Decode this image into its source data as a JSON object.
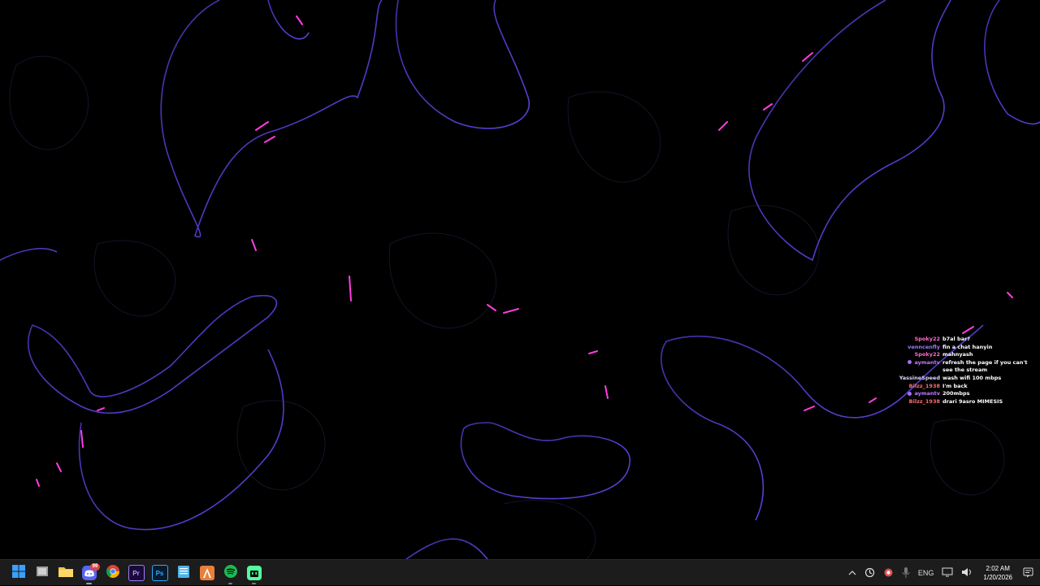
{
  "chat": {
    "messages": [
      {
        "user": "Spoky22",
        "color": "#ff6bd0",
        "badge": false,
        "text": "b7al bar?"
      },
      {
        "user": "venncenfly",
        "color": "#9a7bff",
        "badge": false,
        "text": "fin a chat hanyin"
      },
      {
        "user": "Spoky22",
        "color": "#ff6bd0",
        "badge": false,
        "text": "mahnyash"
      },
      {
        "user": "aymantv",
        "color": "#c07aff",
        "badge": true,
        "text": "refresh the page if you can't see the stream"
      },
      {
        "user": "YassineSpeed",
        "color": "#d9d9ff",
        "badge": false,
        "text": "wash wifi 100 mbps"
      },
      {
        "user": "Bilzz_1938",
        "color": "#ff6e6e",
        "badge": false,
        "text": "I'm back"
      },
      {
        "user": "aymantv",
        "color": "#c07aff",
        "badge": true,
        "text": "200mbps"
      },
      {
        "user": "Bilzz_1938",
        "color": "#ff6e6e",
        "badge": false,
        "text": "drari 9asro MIMESIS"
      }
    ]
  },
  "taskbar": {
    "apps": [
      {
        "name": "start-button",
        "icon": "windows-icon"
      },
      {
        "name": "task-view-button",
        "icon": "task-view-icon"
      },
      {
        "name": "file-explorer-button",
        "icon": "folder-icon"
      },
      {
        "name": "discord-button",
        "icon": "discord-icon",
        "badge": "99"
      },
      {
        "name": "chrome-button",
        "icon": "chrome-icon"
      },
      {
        "name": "premiere-button",
        "icon": "premiere-icon",
        "label": "Pr"
      },
      {
        "name": "photoshop-button",
        "icon": "photoshop-icon",
        "label": "Ps"
      },
      {
        "name": "notepad-button",
        "icon": "notepad-icon"
      },
      {
        "name": "app-a-button",
        "icon": "a-app-icon"
      },
      {
        "name": "spotify-button",
        "icon": "spotify-icon"
      },
      {
        "name": "app-bot-button",
        "icon": "bot-icon"
      }
    ],
    "tray": {
      "language": "ENG",
      "time": "2:02 AM",
      "date": "1/20/2026"
    }
  }
}
